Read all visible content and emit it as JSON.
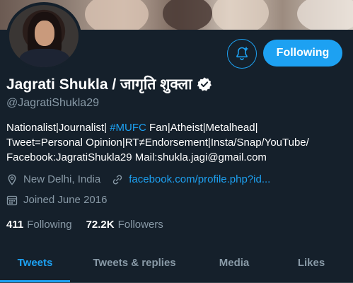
{
  "profile": {
    "name": "Jagrati Shukla / जागृति शुक्ला",
    "handle": "@JagratiShukla29",
    "verified": true,
    "bio": {
      "line1_before": "Nationalist|Journalist| ",
      "line1_hashtag": "#MUFC",
      "line1_after": " Fan|Atheist|Metalhead|",
      "line2": "Tweet=Personal Opinion|RT≠Endorsement|Insta/Snap/YouTube/",
      "line3": "Facebook:JagratiShukla29 Mail:shukla.jagi@gmail.com"
    },
    "location": "New Delhi, India",
    "link": "facebook.com/profile.php?id...",
    "joined": "Joined June 2016"
  },
  "stats": {
    "following_count": "411",
    "following_label": "Following",
    "followers_count": "72.2K",
    "followers_label": "Followers"
  },
  "actions": {
    "follow_label": "Following",
    "notify_icon": "bell-plus-icon"
  },
  "tabs": [
    {
      "label": "Tweets",
      "active": true
    },
    {
      "label": "Tweets & replies",
      "active": false
    },
    {
      "label": "Media",
      "active": false
    },
    {
      "label": "Likes",
      "active": false
    }
  ],
  "colors": {
    "background": "#15202b",
    "accent": "#1da1f2",
    "secondary_text": "#8899a6"
  }
}
